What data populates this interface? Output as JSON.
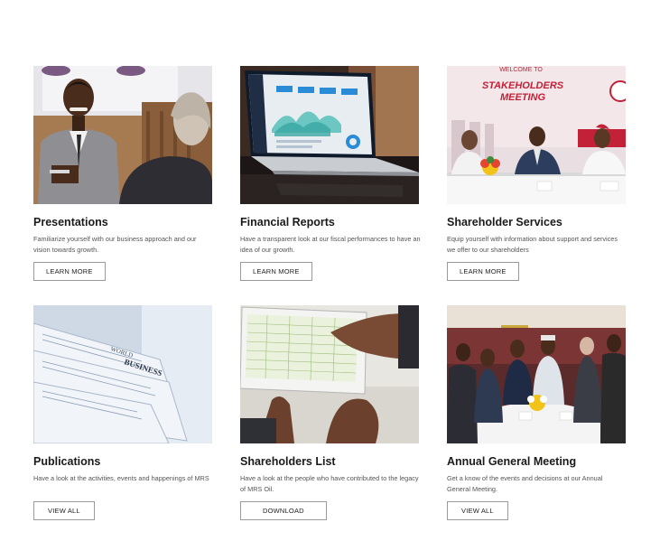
{
  "cards": [
    {
      "image": "presentation-speaker-photo",
      "title": "Presentations",
      "description": "Familiarize yourself with our business approach and our vision towards growth.",
      "button": "LEARN MORE"
    },
    {
      "image": "laptop-dashboard-photo",
      "title": "Financial Reports",
      "description": "Have a transparent look at our fiscal performances to have an idea of our growth.",
      "button": "LEARN MORE"
    },
    {
      "image": "stakeholders-meeting-photo",
      "title": "Shareholder Services",
      "description": "Equip yourself with information about support and services we offer to our shareholders",
      "button": "LEARN MORE",
      "banner_line1": "WELCOME TO",
      "banner_line2": "STAKEHOLDERS",
      "banner_line3": "MEETING"
    },
    {
      "image": "newspapers-photo",
      "title": "Publications",
      "description": "Have a look at the activities, events and happenings of MRS",
      "button": "VIEW ALL",
      "paper_word1": "WORLD",
      "paper_word2": "BUSINESS"
    },
    {
      "image": "tablet-spreadsheet-photo",
      "title": "Shareholders List",
      "description": "Have a look at the people who have contributed to the legacy of MRS Oil.",
      "button": "DOWNLOAD"
    },
    {
      "image": "annual-general-meeting-photo",
      "title": "Annual General Meeting",
      "description": "Get a know of the events and decisions at our Annual General Meeting.",
      "button": "VIEW ALL"
    }
  ]
}
